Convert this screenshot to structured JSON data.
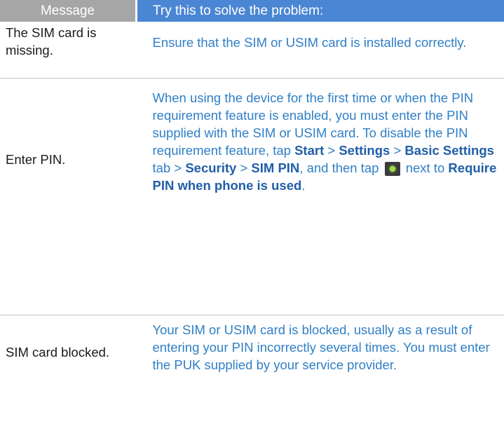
{
  "table": {
    "header": {
      "col1": "Message",
      "col2": "Try this to solve the problem:"
    },
    "rows": [
      {
        "message": "The SIM card is missing.",
        "solution": "Ensure that the SIM or USIM card is installed correctly."
      },
      {
        "message": "Enter PIN.",
        "solution_parts": [
          "When using the device for the first time or when the PIN requirement feature is enabled, you must enter the PIN supplied with the SIM or USIM card. To disable the PIN requirement feature, tap ",
          "Start",
          " > ",
          "Settings",
          " > ",
          "Basic Settings",
          " tab > ",
          "Security",
          " > ",
          "SIM PIN",
          ", and then tap ",
          " next to ",
          "Require PIN when phone is used",
          "."
        ],
        "icon": "checkbox-toggle-icon"
      },
      {
        "message": "SIM card blocked.",
        "solution": "Your SIM or USIM card is blocked, usually as a result of entering your PIN incorrectly several times. You must enter the PUK supplied by your service provider."
      }
    ]
  },
  "colors": {
    "header_message_bg": "#a6a6a6",
    "header_solution_bg": "#4b86d4",
    "solution_text": "#2f7fc6",
    "highlight_text": "#1f5ea8"
  }
}
